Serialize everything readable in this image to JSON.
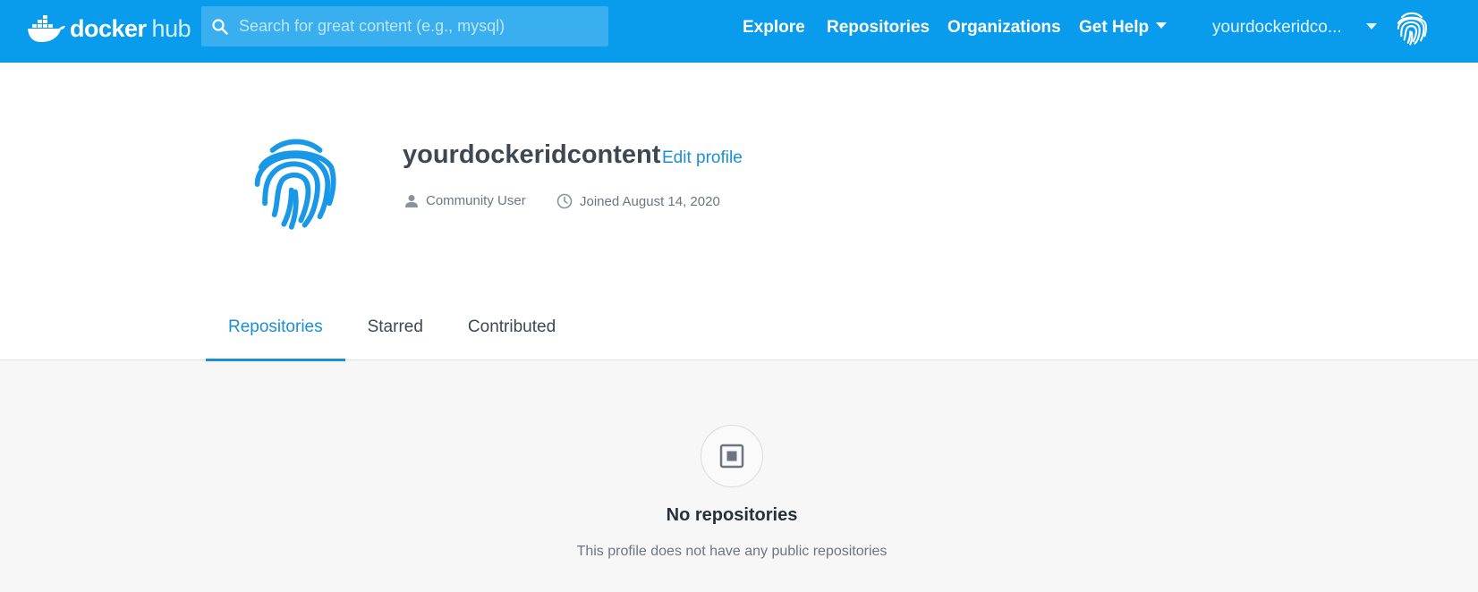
{
  "header": {
    "logo": {
      "word1": "docker",
      "word2": "hub"
    },
    "search": {
      "placeholder": "Search for great content (e.g., mysql)",
      "value": ""
    },
    "nav": {
      "explore": "Explore",
      "repositories": "Repositories",
      "organizations": "Organizations",
      "get_help": "Get Help"
    },
    "user": {
      "name": "yourdockeridco..."
    },
    "colors": {
      "bar": "#099cec",
      "accent": "#1a8fd8"
    }
  },
  "profile": {
    "username": "yourdockeridcontent",
    "edit_label": "Edit profile",
    "role": "Community User",
    "joined": "Joined August 14, 2020"
  },
  "tabs": [
    {
      "label": "Repositories",
      "active": true
    },
    {
      "label": "Starred",
      "active": false
    },
    {
      "label": "Contributed",
      "active": false
    }
  ],
  "empty_state": {
    "icon": "repository-icon",
    "title": "No repositories",
    "subtitle": "This profile does not have any public repositories"
  }
}
